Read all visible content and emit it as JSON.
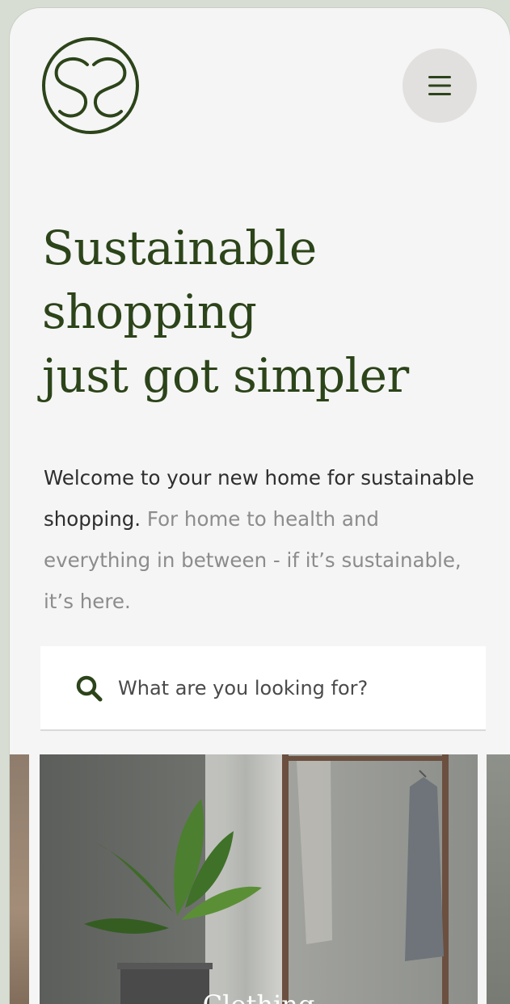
{
  "header": {
    "logo_text": "SS",
    "logo_icon": "ss-monogram-logo",
    "menu_icon": "hamburger-menu-icon"
  },
  "hero": {
    "headline_lines": [
      "Sustainable",
      "shopping",
      "just got simpler"
    ],
    "intro_strong": "Welcome to your new home for sustainable shopping.",
    "intro_rest": " For home to health and everything in between - if it’s sustainable, it’s here."
  },
  "search": {
    "placeholder": "What are you looking for?",
    "icon": "search-icon"
  },
  "categories": [
    {
      "label": "Clothing"
    }
  ],
  "colors": {
    "brand_green": "#2c4419",
    "background": "#f5f5f5",
    "menu_button_bg": "#e2e0df",
    "body_text": "#2e2e2e",
    "muted_text": "#8c8c8c"
  }
}
